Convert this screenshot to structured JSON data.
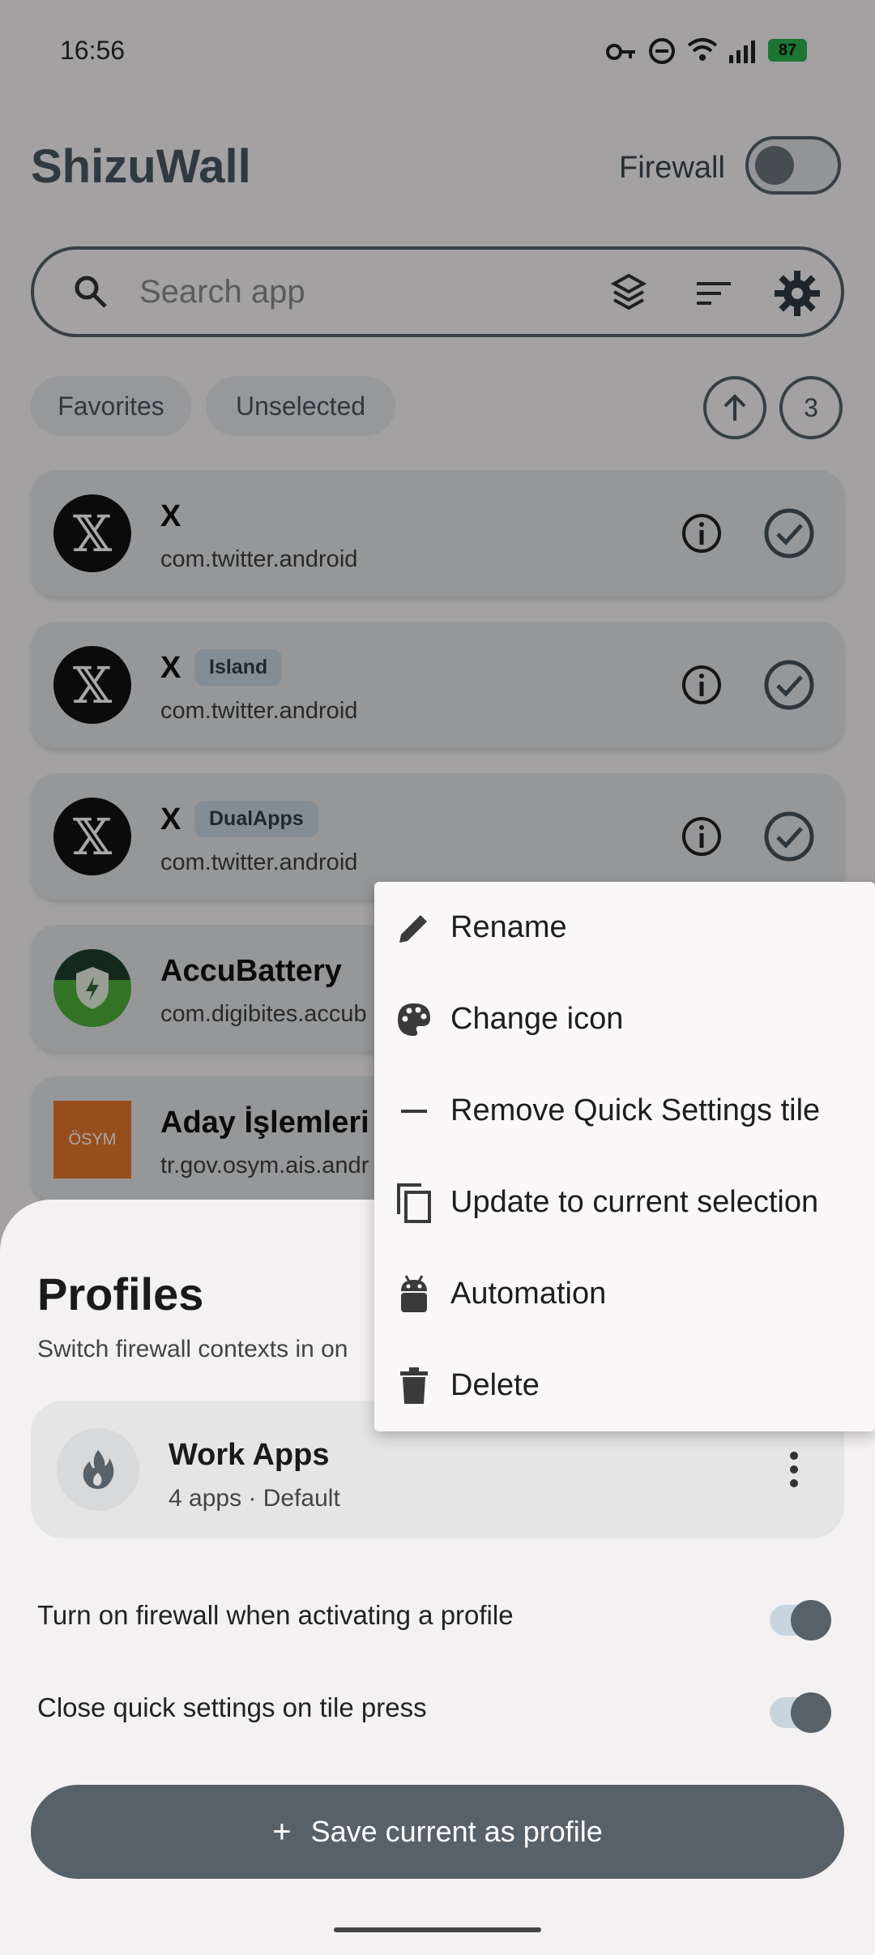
{
  "status": {
    "time": "16:56",
    "battery": "87"
  },
  "header": {
    "app_title": "ShizuWall",
    "firewall_label": "Firewall"
  },
  "search": {
    "placeholder": "Search app"
  },
  "filters": {
    "favorites": "Favorites",
    "unselected": "Unselected",
    "count": "3"
  },
  "apps": [
    {
      "name": "X",
      "tag": "",
      "package": "com.twitter.android"
    },
    {
      "name": "X",
      "tag": "Island",
      "package": "com.twitter.android"
    },
    {
      "name": "X",
      "tag": "DualApps",
      "package": "com.twitter.android"
    },
    {
      "name": "AccuBattery",
      "tag": "",
      "package": "com.digibites.accub"
    },
    {
      "name": "Aday İşlemleri",
      "tag": "",
      "package": "tr.gov.osym.ais.andr",
      "icon_text": "ÖSYM"
    }
  ],
  "profiles": {
    "title": "Profiles",
    "subtitle": "Switch firewall contexts in on",
    "profile_name": "Work Apps",
    "profile_meta": "4 apps · Default",
    "setting_firewall": "Turn on firewall when activating a profile",
    "setting_close_qs": "Close quick settings on tile press",
    "save_button": "Save current as profile"
  },
  "menu": {
    "rename": "Rename",
    "change_icon": "Change icon",
    "remove_tile": "Remove Quick Settings tile",
    "update_selection": "Update to current selection",
    "automation": "Automation",
    "delete": "Delete"
  }
}
